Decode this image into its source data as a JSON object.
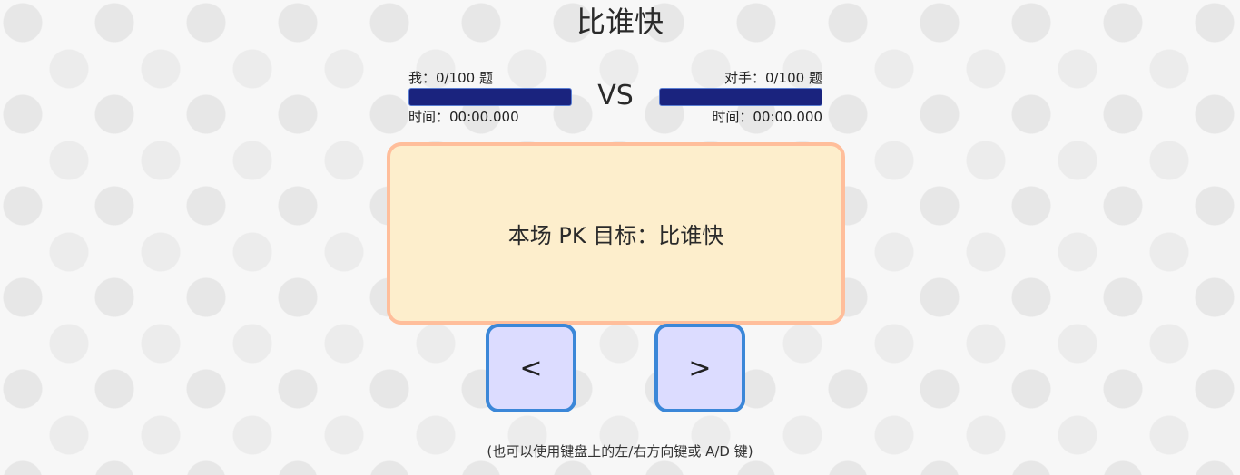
{
  "title": "比谁快",
  "me": {
    "progress_label": "我：0/100 题",
    "time_label": "时间：00:00.000",
    "progress_fraction": 0
  },
  "opponent": {
    "progress_label": "对手：0/100 题",
    "time_label": "时间：00:00.000",
    "progress_fraction": 0
  },
  "vs_label": "VS",
  "board": {
    "message": "本场 PK 目标：比谁快"
  },
  "controls": {
    "left_label": "<",
    "right_label": ">"
  },
  "hint": "(也可以使用键盘上的左/右方向键或 A/D 键)",
  "colors": {
    "bar_bg": "#1a237e",
    "board_bg": "#fdeecc",
    "board_border": "#ffbe9b",
    "button_bg": "#dcdcff",
    "button_border": "#3b87d8"
  }
}
